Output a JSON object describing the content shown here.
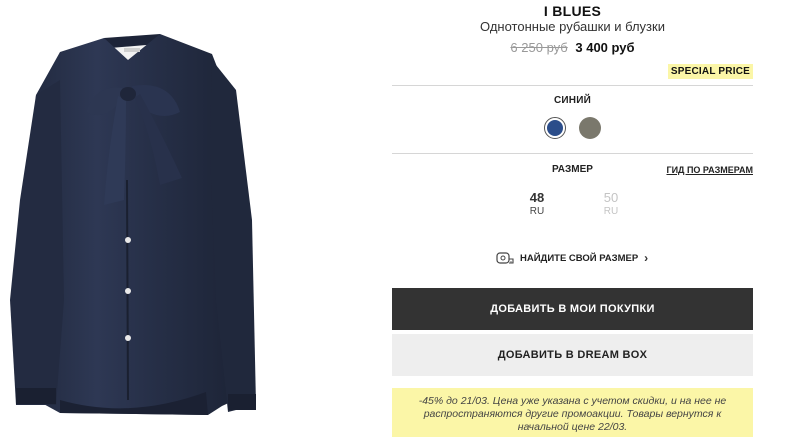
{
  "product": {
    "brand": "I BLUES",
    "subtitle": "Однотонные рубашки и блузки",
    "old_price": "6 250 руб",
    "new_price": "3 400 руб",
    "badge": "SPECIAL PRICE"
  },
  "colors": {
    "label": "СИНИЙ",
    "options": [
      {
        "name": "navy",
        "hex": "#2b4d8a",
        "selected": true
      },
      {
        "name": "grey",
        "hex": "#7a786c",
        "selected": false
      }
    ]
  },
  "sizes": {
    "label": "РАЗМЕР",
    "guide_link": "ГИД ПО РАЗМЕРАМ",
    "options": [
      {
        "value": "48",
        "unit": "RU",
        "available": true
      },
      {
        "value": "50",
        "unit": "RU",
        "available": false
      }
    ],
    "find_size": "НАЙДИТЕ СВОЙ РАЗМЕР"
  },
  "actions": {
    "add_to_cart": "ДОБАВИТЬ В МОИ ПОКУПКИ",
    "add_to_dreambox": "ДОБАВИТЬ В DREAM BOX"
  },
  "promo": {
    "text": "-45% до 21/03. Цена уже указана с учетом скидки, и на нее не распространяются другие промоакции. Товары вернутся к начальной цене 22/03."
  },
  "theme": {
    "primary_button": "#333333",
    "secondary_button": "#eeeeee",
    "highlight": "#fbf6a7",
    "garment": "#262e45"
  }
}
